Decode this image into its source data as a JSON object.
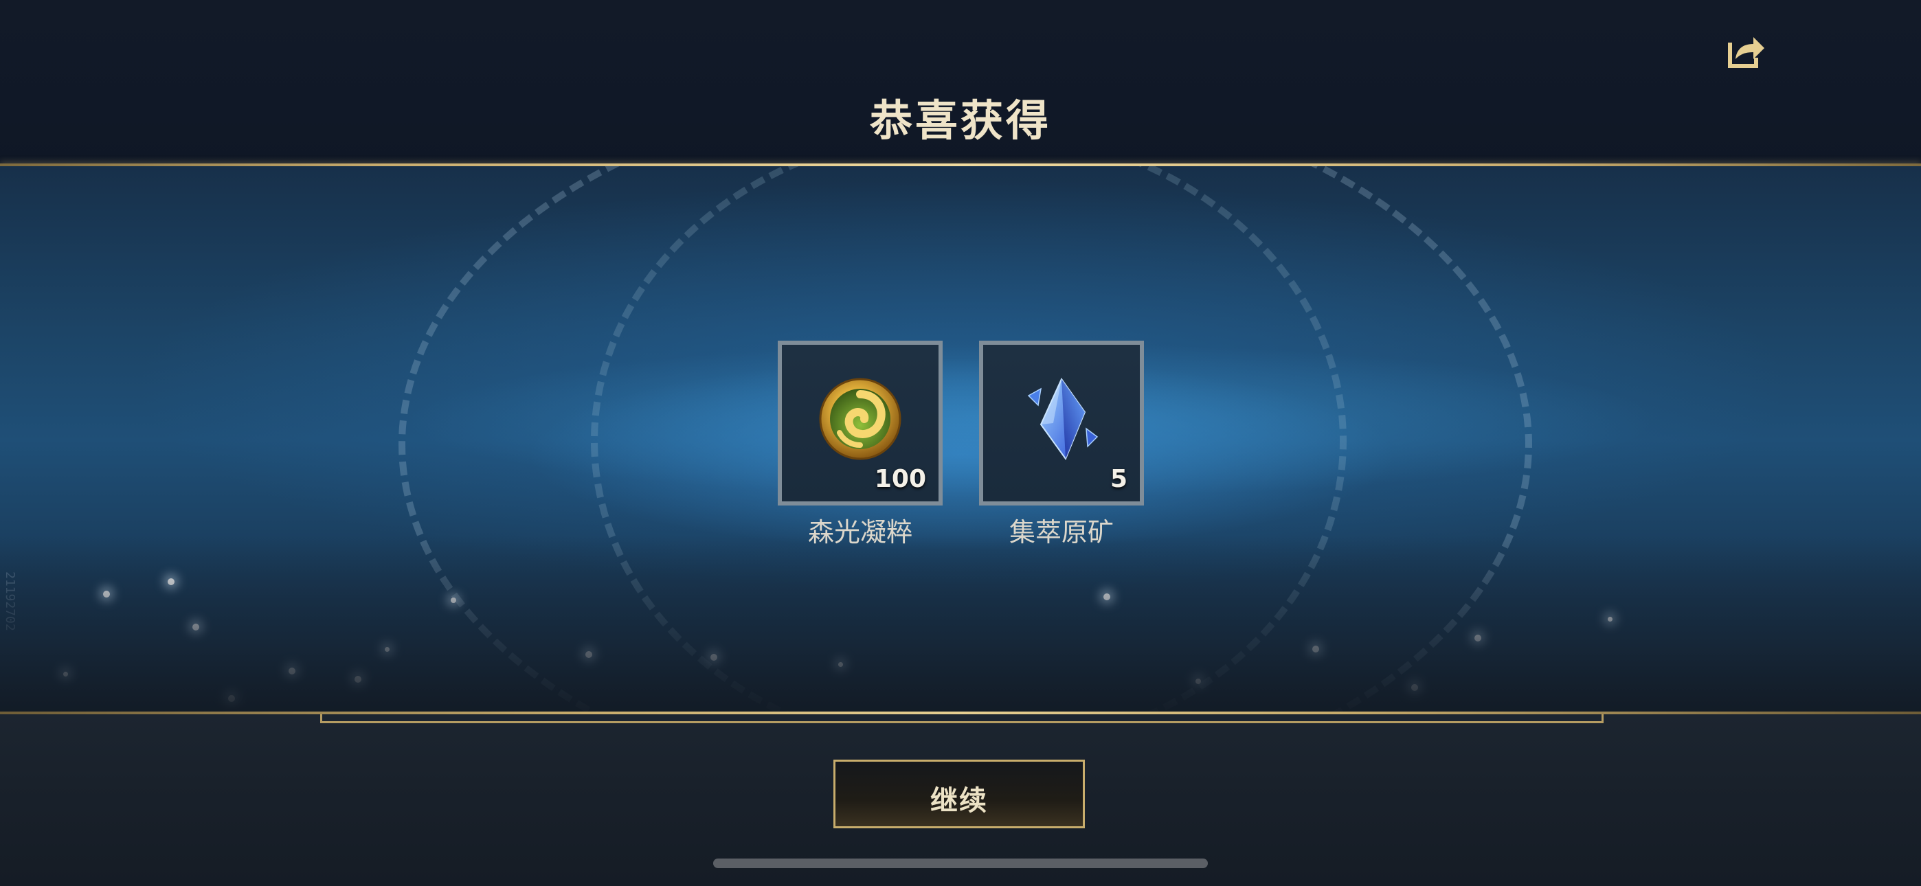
{
  "header": {
    "title": "恭喜获得",
    "share_icon": "share-icon"
  },
  "rewards": [
    {
      "name": "森光凝粹",
      "count": "100",
      "icon": "golden-swirl-emblem-icon"
    },
    {
      "name": "集萃原矿",
      "count": "5",
      "icon": "blue-crystal-icon"
    }
  ],
  "side_code": "21192702",
  "footer": {
    "continue_label": "继续"
  },
  "colors": {
    "gold_accent": "#c8ad6c",
    "title_text": "#efe4c8",
    "box_border": "#7f8d99"
  }
}
